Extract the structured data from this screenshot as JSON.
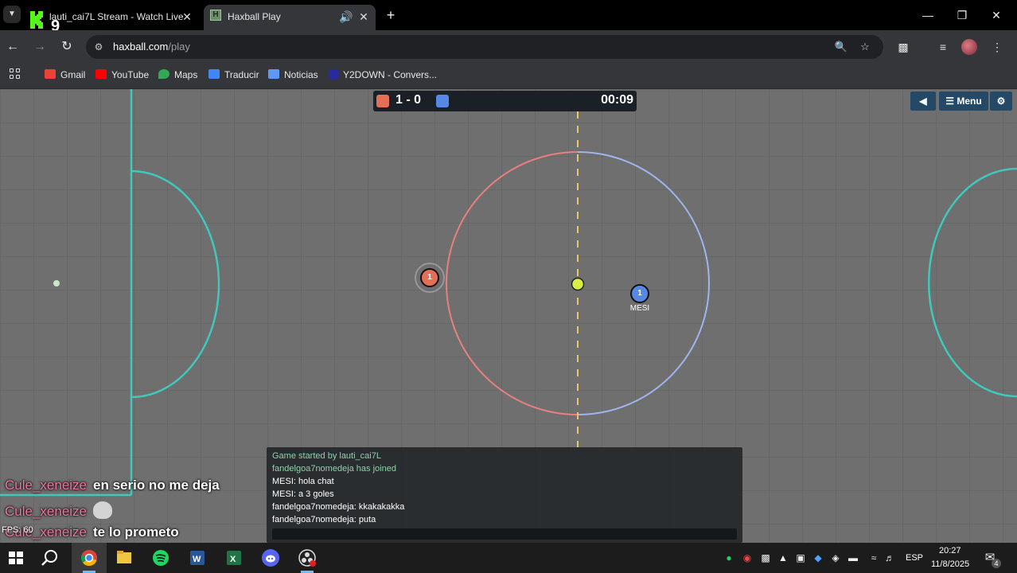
{
  "browser": {
    "tabs": [
      {
        "label": "lauti_cai7L Stream - Watch Live",
        "favicon": "kick-icon",
        "favicon_text": "9"
      },
      {
        "label": "Haxball Play",
        "favicon": "haxball-icon",
        "favicon_text": "H",
        "audio": true
      }
    ],
    "url_host": "haxball.com",
    "url_path": "/play",
    "bookmarks": [
      {
        "label": "Gmail",
        "color": "#ea4335"
      },
      {
        "label": "YouTube",
        "color": "#ff0000"
      },
      {
        "label": "Maps",
        "color": "#34a853"
      },
      {
        "label": "Traducir",
        "color": "#4285f4"
      },
      {
        "label": "Noticias",
        "color": "#4285f4"
      },
      {
        "label": "Y2DOWN - Convers...",
        "color": "#2a2aa0"
      }
    ]
  },
  "game": {
    "score": "1 - 0",
    "time": "00:09",
    "red_color": "#e56e56",
    "blue_color": "#5689e5",
    "menu_label": "Menu",
    "red_player": {
      "number": "1"
    },
    "blue_player": {
      "number": "1",
      "name": "MESI"
    },
    "chat": [
      {
        "text": "Game started by lauti_cai7L",
        "type": "system"
      },
      {
        "text": "fandelgoa7nomedeja has joined",
        "type": "system"
      },
      {
        "text": "MESI: hola chat",
        "type": "user"
      },
      {
        "text": "MESI: a 3 goles",
        "type": "user"
      },
      {
        "text": "fandelgoa7nomedeja: kkakakakka",
        "type": "user"
      },
      {
        "text": "fandelgoa7nomedeja: puta",
        "type": "user"
      }
    ],
    "fps_label": "FPS: 60"
  },
  "stream_chat": [
    {
      "user": "Cule_xeneize",
      "message": "en serio no me deja"
    },
    {
      "user": "Cule_xeneize",
      "message": "",
      "emote": "cat-emote"
    },
    {
      "user": "Cule_xeneize",
      "message": "te lo prometo"
    }
  ],
  "taskbar": {
    "apps": [
      "start-icon",
      "search-icon",
      "chrome-icon",
      "explorer-icon",
      "spotify-icon",
      "word-icon",
      "excel-icon",
      "discord-icon",
      "obs-icon"
    ],
    "language": "ESP",
    "time": "20:27",
    "date": "11/8/2025",
    "notifications": "4"
  }
}
